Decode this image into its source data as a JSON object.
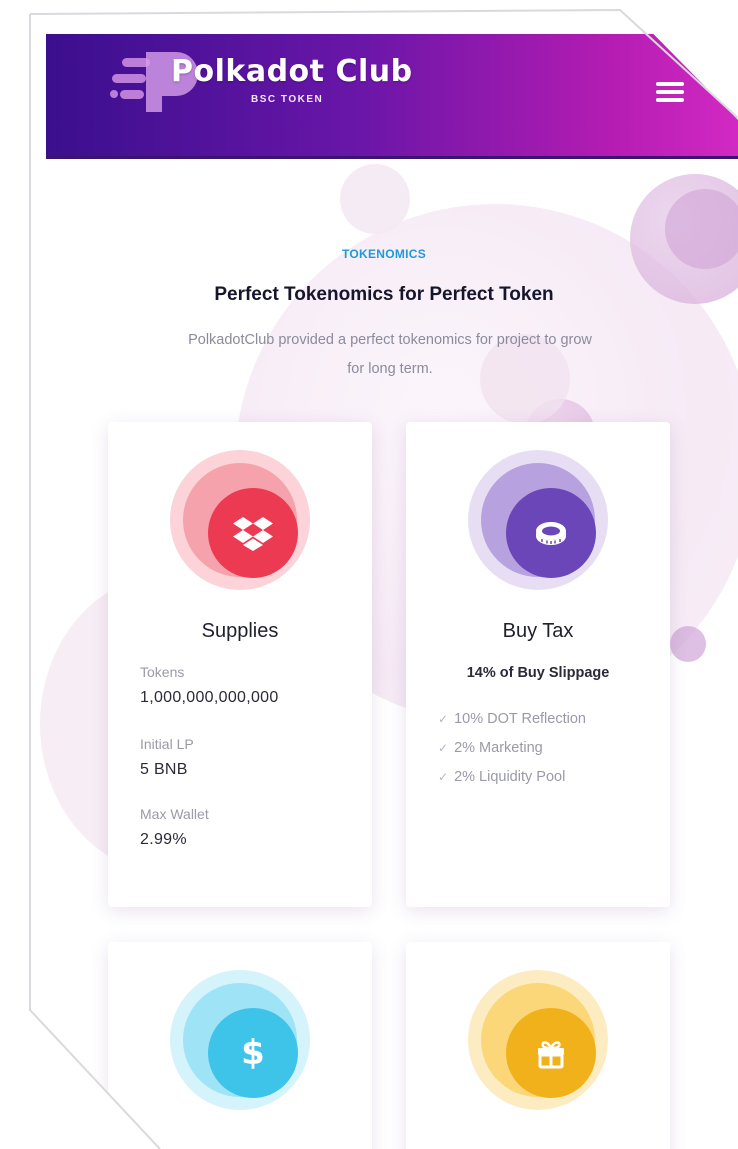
{
  "header": {
    "brand_name": "Polkadot Club",
    "brand_subtitle": "BSC TOKEN",
    "gradient_start": "#3a0f8e",
    "gradient_end": "#d42ac4",
    "menu_icon": "hamburger-icon"
  },
  "intro": {
    "eyebrow": "TOKENOMICS",
    "title": "Perfect Tokenomics for Perfect Token",
    "description": "PolkadotClub provided a perfect tokenomics for project to grow for long term.",
    "eyebrow_color": "#1f9ad9"
  },
  "cards": [
    {
      "title": "Supplies",
      "icon": "dropbox-icon",
      "color": "#ec3a52",
      "fields": [
        {
          "label": "Tokens",
          "value": "1,000,000,000,000"
        },
        {
          "label": "Initial LP",
          "value": "5 BNB"
        },
        {
          "label": "Max Wallet",
          "value": "2.99%"
        }
      ]
    },
    {
      "title": "Buy Tax",
      "icon": "coin-icon",
      "color": "#6a46b8",
      "subtitle": "14% of Buy Slippage",
      "items": [
        "10% DOT Reflection",
        "2% Marketing",
        "2% Liquidity Pool"
      ]
    },
    {
      "icon": "dollar-icon",
      "color": "#3fc4e9"
    },
    {
      "icon": "gift-icon",
      "color": "#f1b11b"
    }
  ]
}
